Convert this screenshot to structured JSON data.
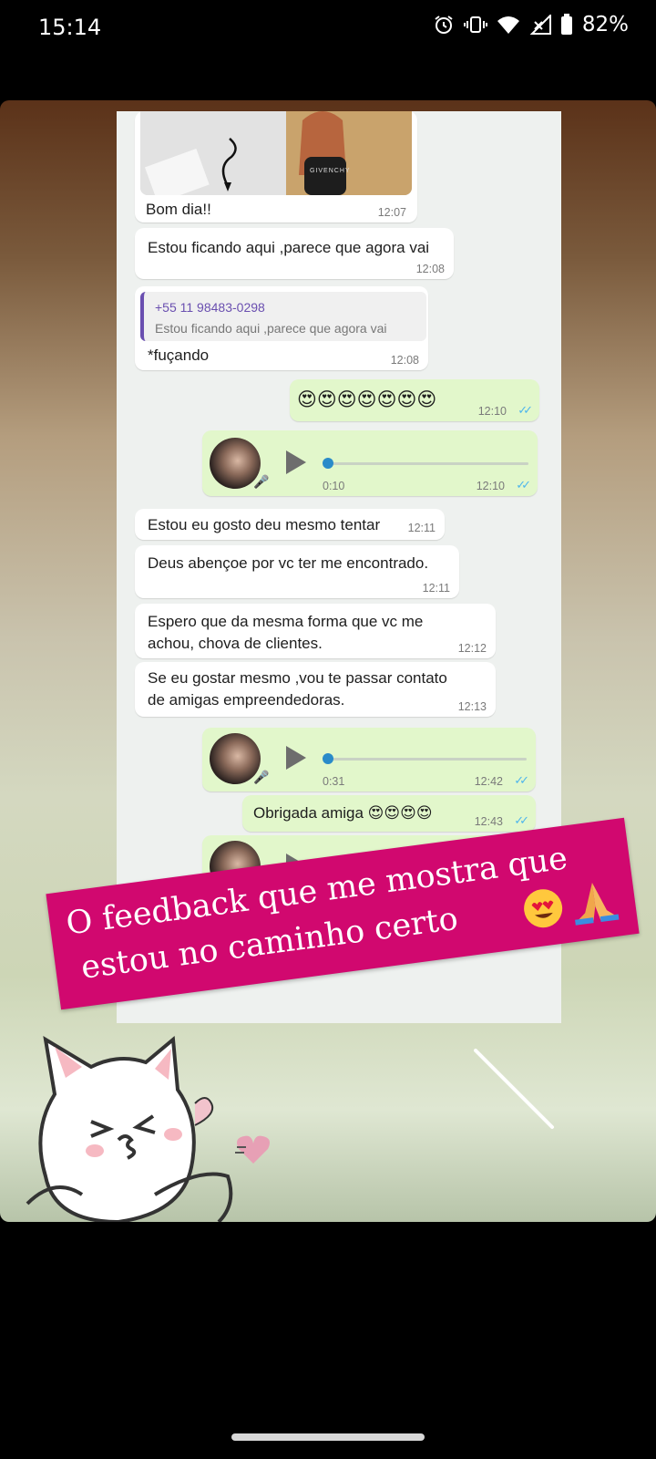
{
  "status_bar": {
    "time": "15:14",
    "battery": "82%",
    "icons": [
      "alarm-icon",
      "vibrate-icon",
      "wifi-icon",
      "signal-icon",
      "battery-icon"
    ]
  },
  "chat": {
    "messages": [
      {
        "type": "image",
        "caption": "Bom dia!!",
        "time": "12:07",
        "photo_text": "GIVENCHY"
      },
      {
        "type": "text",
        "text": "Estou ficando aqui ,parece que agora vai",
        "time": "12:08"
      },
      {
        "type": "reply",
        "quote_sender": "+55 11 98483-0298",
        "quote_text": "Estou ficando aqui ,parece que agora vai",
        "text": "*fuçando",
        "time": "12:08"
      },
      {
        "type": "out-text",
        "text": "😍😍😍😍😍😍😍",
        "time": "12:10"
      },
      {
        "type": "out-audio",
        "duration": "0:10",
        "time": "12:10"
      },
      {
        "type": "text",
        "text": "Estou eu gosto deu mesmo tentar",
        "time": "12:11"
      },
      {
        "type": "text",
        "text": "Deus abençoe  por vc ter me encontrado.",
        "time": "12:11"
      },
      {
        "type": "text",
        "lines": [
          "Espero que da mesma forma que vc me",
          "achou, chova de clientes."
        ],
        "time": "12:12"
      },
      {
        "type": "text",
        "lines": [
          "Se eu gostar mesmo ,vou te passar contato",
          "de amigas empreendedoras."
        ],
        "time": "12:13"
      },
      {
        "type": "out-audio",
        "duration": "0:31",
        "time": "12:42"
      },
      {
        "type": "out-text",
        "text": "Obrigada amiga 😍😍😍😍",
        "time": "12:43"
      },
      {
        "type": "out-audio-partial"
      }
    ],
    "ticks": "✓✓"
  },
  "banner": {
    "line1": "O feedback que me mostra que",
    "line2": "estou no caminho certo",
    "emojis": [
      "heart-eyes-emoji",
      "praying-hands-emoji"
    ]
  },
  "colors": {
    "banner": "#d1086f",
    "incoming": "#ffffff",
    "outgoing": "#e2f7cb",
    "ticks": "#4fb6ec"
  }
}
